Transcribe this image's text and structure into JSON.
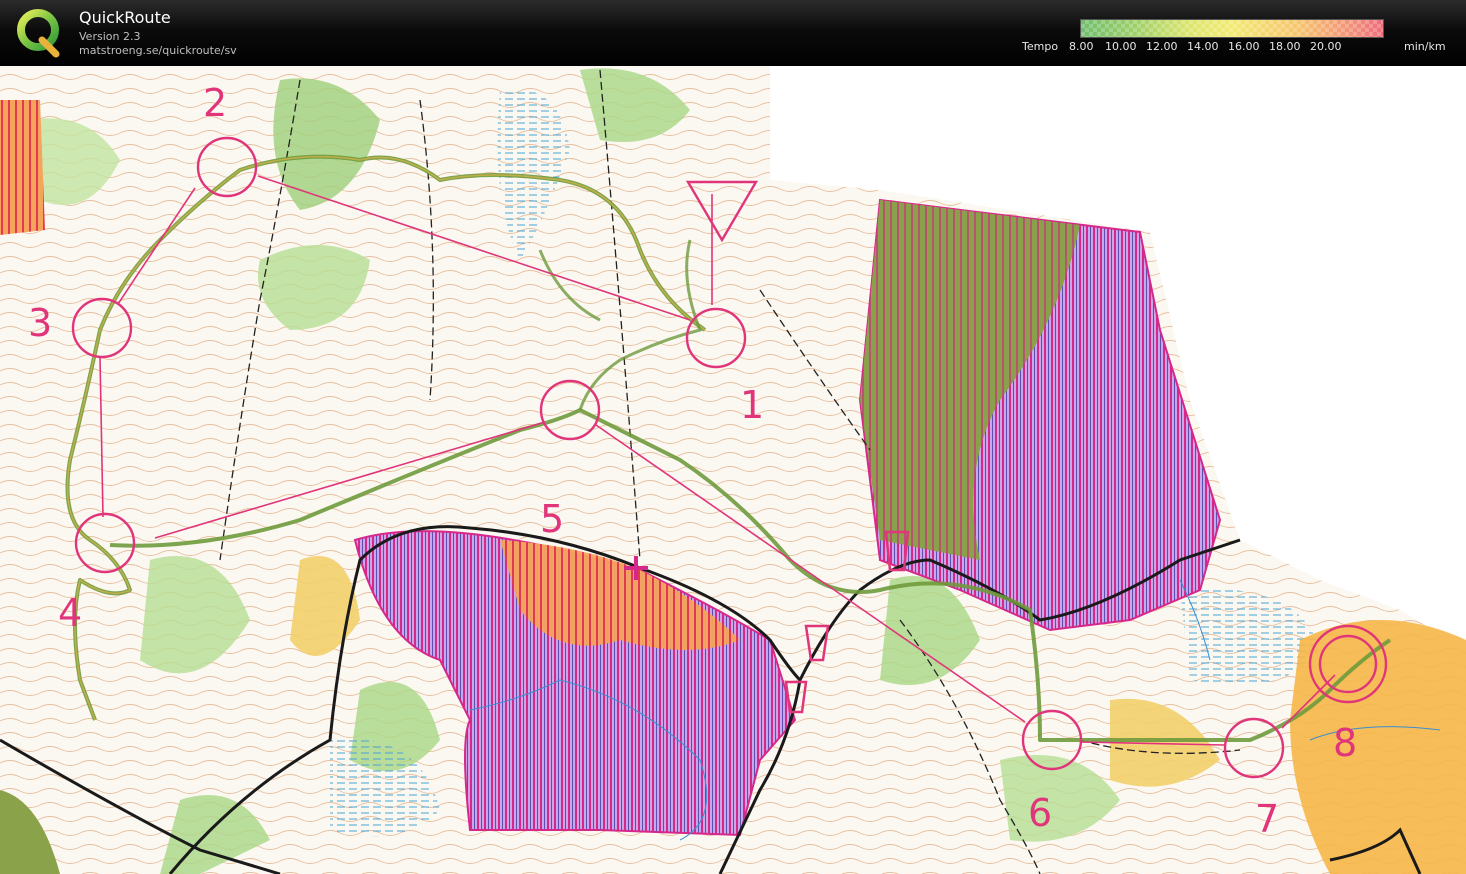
{
  "header": {
    "app_title": "QuickRoute",
    "version": "Version 2.3",
    "url": "matstroeng.se/quickroute/sv",
    "logo_letter": "Q"
  },
  "legend": {
    "title": "Tempo",
    "ticks": [
      "8.00",
      "10.00",
      "12.00",
      "14.00",
      "16.00",
      "18.00",
      "20.00"
    ],
    "unit": "min/km",
    "colors": {
      "slow": "#ee6c7c",
      "medium": "#f3ea74",
      "fast": "#70be6e"
    }
  },
  "map": {
    "course_color": "#e0357a",
    "route_color": "#8a9a3a",
    "control_labels": [
      "1",
      "2",
      "3",
      "4",
      "5",
      "6",
      "7",
      "8"
    ]
  }
}
